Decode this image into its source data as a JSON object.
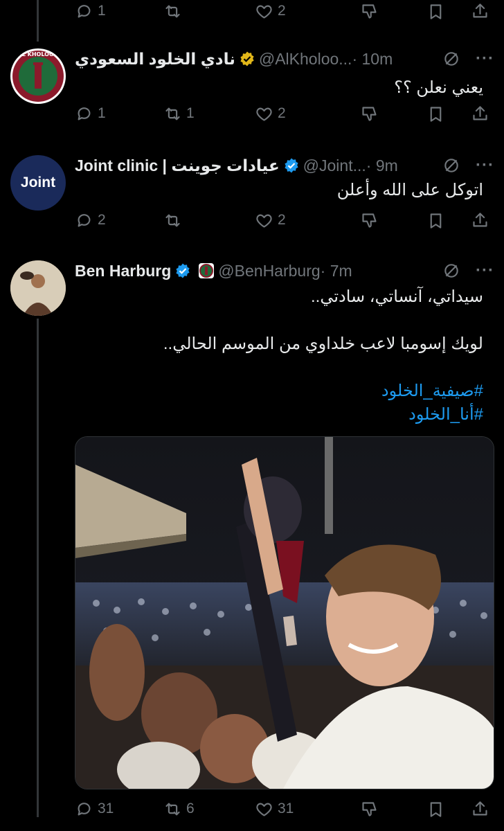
{
  "top_actions": {
    "replies": "1",
    "retweets": "",
    "likes": "2"
  },
  "tweets": [
    {
      "name": "نادي الخلود السعودي",
      "handle": "@AlKholoo...",
      "time": "· 10m",
      "text": "يعني نعلن ؟؟",
      "avatar_text": "AL KHOLOOD",
      "badge": "gold",
      "actions": {
        "replies": "1",
        "retweets": "1",
        "likes": "2"
      }
    },
    {
      "name": "Joint clinic | عيادات جوينت",
      "handle": "@Joint...",
      "time": "· 9m",
      "text": "اتوكل على الله وأعلن",
      "avatar_text": "Joint",
      "badge": "blue",
      "actions": {
        "replies": "2",
        "retweets": "",
        "likes": "2"
      }
    },
    {
      "name": "Ben Harburg",
      "handle": "@BenHarburg",
      "time": "· 7m",
      "text_lines": [
        "سيداتي، آنساتي، سادتي..",
        "لويك إسومبا لاعب خلداوي من الموسم الحالي.."
      ],
      "hashtags": [
        "#صيفية_الخلود",
        "#أنا_الخلود"
      ],
      "badge": "blue",
      "actions": {
        "replies": "31",
        "retweets": "6",
        "likes": "31"
      }
    }
  ],
  "colors": {
    "background": "#000000",
    "text": "#e7e9ea",
    "muted": "#71767b",
    "link": "#1d9bf0",
    "verified_blue": "#1d9bf0",
    "verified_gold": "#e2b719",
    "club_green": "#1f6b3a",
    "club_red": "#8b1a2b"
  },
  "icons": [
    "reply-icon",
    "retweet-icon",
    "like-icon",
    "downvote-icon",
    "bookmark-icon",
    "share-icon",
    "grok-icon",
    "more-icon",
    "verified-badge-icon"
  ]
}
